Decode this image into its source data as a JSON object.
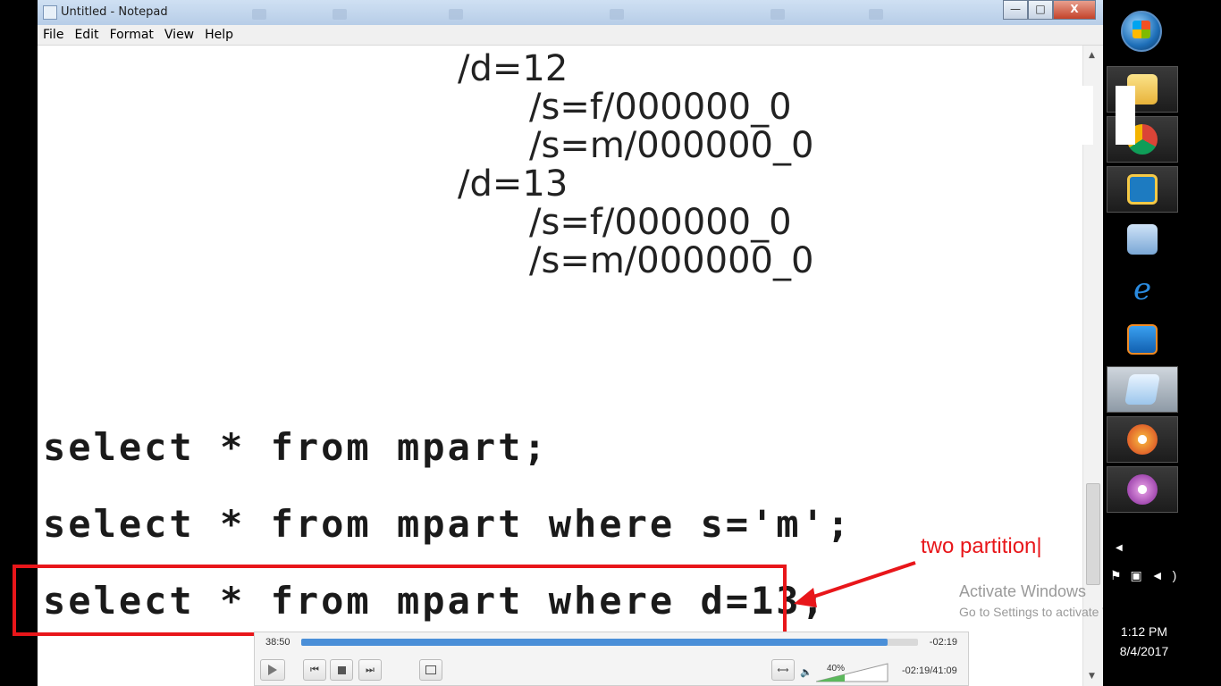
{
  "window": {
    "title": "Untitled - Notepad",
    "buttons": {
      "minimize": "—",
      "maximize": "□",
      "close": "X"
    }
  },
  "menu": [
    "File",
    "Edit",
    "Format",
    "View",
    "Help"
  ],
  "editor_lines": {
    "l1": "/d=12",
    "l2": "/s=f/000000_0",
    "l3": "/s=m/000000_0",
    "l4": "/d=13",
    "l5": "/s=f/000000_0",
    "l6": "/s=m/000000_0",
    "q1": "select * from mpart;",
    "q2": "select * from mpart where s='m';",
    "q3": "select * from mpart where d=13;"
  },
  "annotation": {
    "text": "two partition|",
    "color": "#e8161a"
  },
  "watermark": {
    "line1": "Activate Windows",
    "line2": "Go to Settings to activate Windows."
  },
  "player": {
    "elapsed": "38:50",
    "remaining": "-02:19",
    "progress": 0.95,
    "volume": "40%",
    "time_display": "-02:19/41:09",
    "accent": "#4a8fd8"
  },
  "taskbar": {
    "items": [
      "file-explorer-icon",
      "chrome-icon",
      "virtualbox-icon",
      "picture-viewer-icon",
      "internet-explorer-icon",
      "media-player-icon",
      "notepad-icon",
      "flower-app-icon-1",
      "flower-app-icon-2"
    ],
    "clock_time": "1:12 PM",
    "clock_date": "8/4/2017"
  }
}
